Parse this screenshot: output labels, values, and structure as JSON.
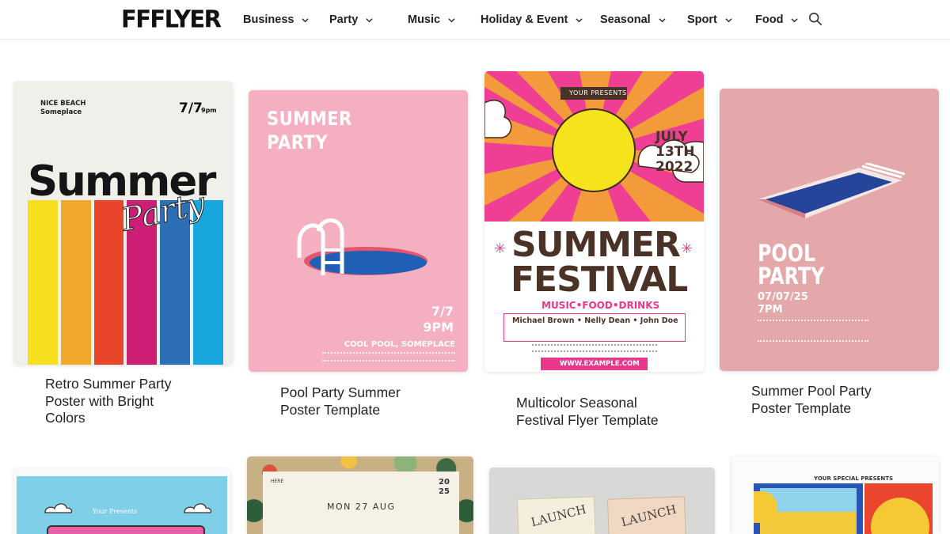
{
  "site": {
    "logo": "FFFLYER",
    "nav": [
      "Business",
      "Party",
      "Music",
      "Holiday & Event",
      "Seasonal",
      "Sport",
      "Food"
    ]
  },
  "cards": [
    {
      "title_lines": [
        "Retro Summer Party",
        "Poster with Bright",
        "Colors"
      ],
      "poster": {
        "venue": "NICE BEACH",
        "place": "Someplace",
        "date": "7/7",
        "time": "9pm",
        "headline": "Summer",
        "script": "Party",
        "stripe_colors": [
          "#f6df1f",
          "#f0a92a",
          "#e8452a",
          "#cc1e74",
          "#2c6fb6",
          "#17a7dc"
        ]
      }
    },
    {
      "title_lines": [
        "Pool Party Summer",
        "Poster Template"
      ],
      "poster": {
        "headline_1": "SUMMER",
        "headline_2": "PARTY",
        "date": "7/7",
        "time": "9PM",
        "location": "COOL POOL, SOMEPLACE",
        "bg": "#f4afc1"
      }
    },
    {
      "title_lines": [
        "Multicolor Seasonal",
        "Festival Flyer Template"
      ],
      "poster": {
        "presenter": "YOUR PRESENTS",
        "date_1": "JULY",
        "date_2": "13TH",
        "date_3": "2022",
        "headline_1": "SUMMER",
        "headline_2": "FESTIVAL",
        "tagline": "MUSIC•FOOD•DRINKS",
        "lineup": "Michael Brown • Nelly Dean • John Doe",
        "url": "WWW.EXAMPLE.COM"
      }
    },
    {
      "title_lines": [
        "Summer Pool Party",
        "Poster Template"
      ],
      "poster": {
        "headline_1": "POOL",
        "headline_2": "PARTY",
        "date": "07/07/25",
        "time": "7PM",
        "bg": "#e5a8aa"
      }
    }
  ],
  "row2": [
    {
      "label": "Your Presents"
    },
    {
      "label": "HERE",
      "date": "MON 27 AUG",
      "year_1": "20",
      "year_2": "25"
    },
    {
      "word_1": "LAUNCH",
      "word_2": "LAUNCH"
    },
    {
      "label": "YOUR SPECIAL PRESENTS"
    }
  ],
  "colors": {
    "accent_pink": "#e8388c",
    "festival_orange": "#f39a3a",
    "festival_brown": "#4a3326"
  }
}
